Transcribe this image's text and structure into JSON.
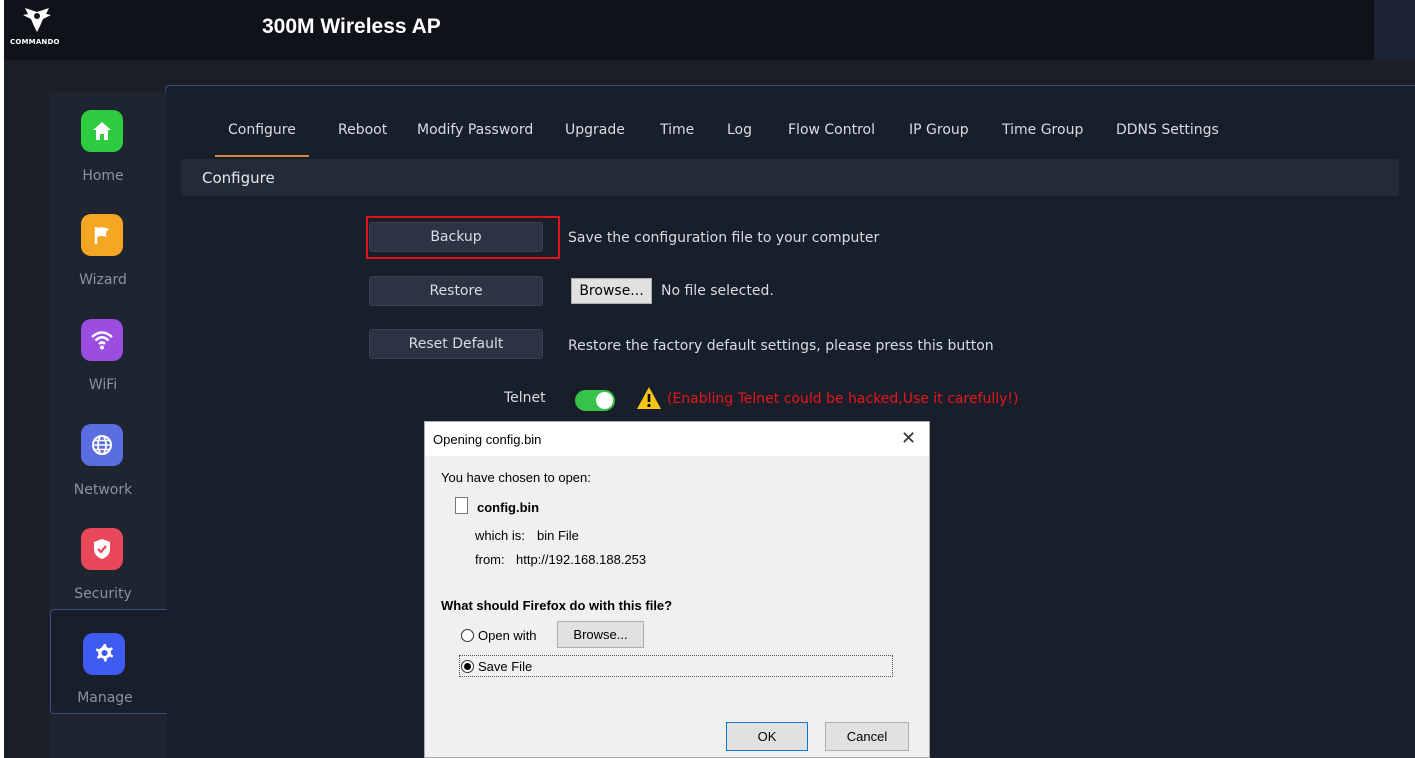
{
  "header": {
    "logo_text": "COMMANDO",
    "title": "300M Wireless AP"
  },
  "sidebar": {
    "items": [
      {
        "label": "Home",
        "icon": "home-icon",
        "color": "#2ecc40"
      },
      {
        "label": "Wizard",
        "icon": "flag-icon",
        "color": "#f5a623"
      },
      {
        "label": "WiFi",
        "icon": "wifi-icon",
        "color": "#9b4de0"
      },
      {
        "label": "Network",
        "icon": "globe-icon",
        "color": "#5b6ee1"
      },
      {
        "label": "Security",
        "icon": "shield-icon",
        "color": "#e8485a"
      },
      {
        "label": "Manage",
        "icon": "gear-icon",
        "color": "#3d5af1",
        "active": true
      }
    ]
  },
  "tabs": [
    {
      "label": "Configure",
      "active": true
    },
    {
      "label": "Reboot"
    },
    {
      "label": "Modify Password"
    },
    {
      "label": "Upgrade"
    },
    {
      "label": "Time"
    },
    {
      "label": "Log"
    },
    {
      "label": "Flow Control"
    },
    {
      "label": "IP Group"
    },
    {
      "label": "Time Group"
    },
    {
      "label": "DDNS Settings"
    }
  ],
  "section": {
    "title": "Configure"
  },
  "configure": {
    "backup_label": "Backup",
    "backup_desc": "Save the configuration file to your computer",
    "restore_label": "Restore",
    "browse_label": "Browse...",
    "no_file": "No file selected.",
    "reset_label": "Reset Default",
    "reset_desc": "Restore the factory default settings, please press this button",
    "telnet_label": "Telnet",
    "telnet_enabled": true,
    "telnet_warning": "(Enabling Telnet could be hacked,Use it carefully!)"
  },
  "dialog": {
    "title": "Opening config.bin",
    "close": "✕",
    "chosen": "You have chosen to open:",
    "file_name": "config.bin",
    "which_label": "which is:",
    "which_value": "bin File",
    "from_label": "from:",
    "from_value": "http://192.168.188.253",
    "question": "What should Firefox do with this file?",
    "open_with": "Open with",
    "browse": "Browse...",
    "save_file": "Save File",
    "selected_option": "Save File",
    "ok": "OK",
    "cancel": "Cancel"
  },
  "colors": {
    "accent_tab": "#d08a3c",
    "highlight": "#e0141c",
    "warning_text": "#e8141c",
    "toggle_on": "#35c449"
  }
}
